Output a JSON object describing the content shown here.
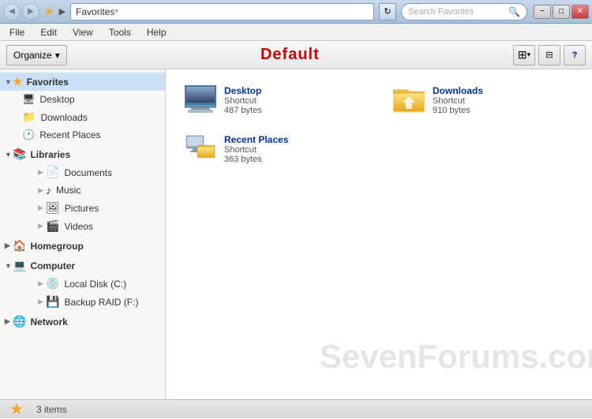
{
  "titleBar": {
    "addressLabel": "Favorites",
    "searchPlaceholder": "Search Favorites",
    "backTooltip": "Back",
    "forwardTooltip": "Forward",
    "refreshTooltip": "Refresh",
    "minimizeLabel": "−",
    "maximizeLabel": "□",
    "closeLabel": "✕"
  },
  "menuBar": {
    "items": [
      "File",
      "Edit",
      "View",
      "Tools",
      "Help"
    ]
  },
  "toolbar": {
    "organizeLabel": "Organize",
    "organizeArrow": "▾",
    "pageTitle": "Default",
    "viewIconLabel": "⊞",
    "paneIconLabel": "⊟",
    "helpIconLabel": "?"
  },
  "sidebar": {
    "sections": [
      {
        "id": "favorites",
        "label": "Favorites",
        "icon": "⭐",
        "expanded": true,
        "selected": true,
        "children": [
          {
            "id": "desktop",
            "label": "Desktop",
            "icon": "🖥"
          },
          {
            "id": "downloads",
            "label": "Downloads",
            "icon": "📁",
            "selected": false
          },
          {
            "id": "recent-places",
            "label": "Recent Places",
            "icon": "🕐"
          }
        ]
      },
      {
        "id": "libraries",
        "label": "Libraries",
        "icon": "📚",
        "expanded": true,
        "children": [
          {
            "id": "documents",
            "label": "Documents",
            "icon": "📄"
          },
          {
            "id": "music",
            "label": "Music",
            "icon": "♪"
          },
          {
            "id": "pictures",
            "label": "Pictures",
            "icon": "🖼"
          },
          {
            "id": "videos",
            "label": "Videos",
            "icon": "🎬"
          }
        ]
      },
      {
        "id": "homegroup",
        "label": "Homegroup",
        "icon": "🏠",
        "expanded": false,
        "children": []
      },
      {
        "id": "computer",
        "label": "Computer",
        "icon": "💻",
        "expanded": true,
        "children": [
          {
            "id": "local-disk-c",
            "label": "Local Disk (C:)",
            "icon": "💿"
          },
          {
            "id": "backup-raid-f",
            "label": "Backup RAID (F:)",
            "icon": "💾"
          }
        ]
      },
      {
        "id": "network",
        "label": "Network",
        "icon": "🌐",
        "expanded": false,
        "children": []
      }
    ]
  },
  "content": {
    "items": [
      {
        "id": "desktop",
        "name": "Desktop",
        "type": "Shortcut",
        "size": "487 bytes",
        "iconType": "desktop"
      },
      {
        "id": "downloads",
        "name": "Downloads",
        "type": "Shortcut",
        "size": "910 bytes",
        "iconType": "folder-yellow"
      },
      {
        "id": "recent-places",
        "name": "Recent Places",
        "type": "Shortcut",
        "size": "363 bytes",
        "iconType": "network-folder"
      }
    ]
  },
  "statusBar": {
    "itemCount": "3 items",
    "watermark": "SevenForums.com"
  }
}
